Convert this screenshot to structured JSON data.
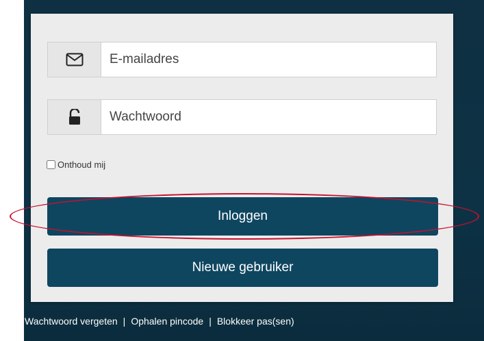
{
  "login": {
    "email_placeholder": "E-mailadres",
    "password_placeholder": "Wachtwoord",
    "email_icon": "envelope-icon",
    "password_icon": "unlock-icon",
    "remember_label": "Onthoud mij",
    "remember_checked": false,
    "login_button": "Inloggen",
    "new_user_button": "Nieuwe gebruiker"
  },
  "footer": {
    "links": [
      "Wachtwoord vergeten",
      "Ophalen pincode",
      "Blokkeer pas(sen)"
    ],
    "separator": "|"
  },
  "colors": {
    "primary_button": "#0e4660",
    "background_dark": "#0f2f42",
    "card": "#ececec",
    "highlight": "#c8102e"
  }
}
